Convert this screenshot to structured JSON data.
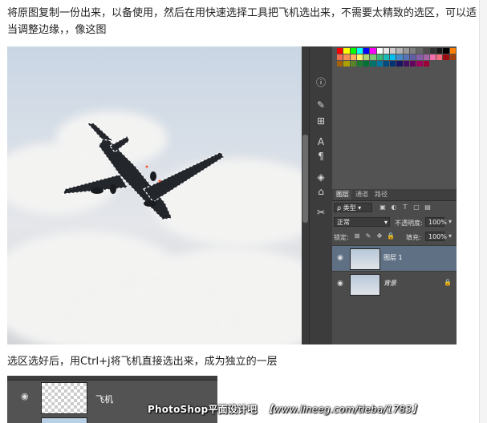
{
  "article": {
    "paragraph_1": "将原图复制一份出来，以备使用，然后在用快速选择工具把飞机选出来，不需要太精致的选区，可以适当调整边缘，，像这图",
    "paragraph_2": "选区选好后，用Ctrl+j将飞机直接选出来，成为独立的一层"
  },
  "toolbar_icons": [
    "info-icon",
    "brush-preset-icon",
    "clone-source-icon",
    "character-icon",
    "paragraph-icon",
    "3d-icon",
    "tool-presets-icon"
  ],
  "swatch_colors": [
    "#ff0000",
    "#ffff00",
    "#00ff00",
    "#00ffff",
    "#0000ff",
    "#ff00ff",
    "#ffffff",
    "#e6e6e6",
    "#cccccc",
    "#b3b3b3",
    "#999999",
    "#808080",
    "#666666",
    "#4d4d4d",
    "#333333",
    "#1a1a1a",
    "#000000",
    "#ff7f00",
    "#f26c4f",
    "#f68e55",
    "#fbaf5c",
    "#fff467",
    "#acd372",
    "#7cc576",
    "#3bb878",
    "#1abbb4",
    "#00bff3",
    "#438ccb",
    "#5574b9",
    "#605ca8",
    "#855fa8",
    "#a763a8",
    "#f06ea9",
    "#f26d7d",
    "#9e0b0f",
    "#a0410d",
    "#a36209",
    "#aba000",
    "#598527",
    "#1a7b30",
    "#007236",
    "#00746b",
    "#0076a3",
    "#004b80",
    "#003471",
    "#1b1464",
    "#440e62",
    "#630460",
    "#9e005d",
    "#9e0039"
  ],
  "layers_panel": {
    "tabs": [
      "图层",
      "通道",
      "路径"
    ],
    "filter_label": "类型",
    "blend_mode": "正常",
    "opacity_label": "不透明度:",
    "opacity_value": "100%",
    "lock_label": "锁定:",
    "fill_label": "填充:",
    "fill_value": "100%",
    "layers": [
      {
        "name": "图层 1",
        "active": true
      },
      {
        "name": "背景",
        "active": false
      }
    ]
  },
  "second_shot": {
    "layer_name": "飞机"
  },
  "watermark": {
    "brand": "PhotoShop平面设计吧",
    "url": "【www.lineeg.com/tieba/1783】"
  }
}
